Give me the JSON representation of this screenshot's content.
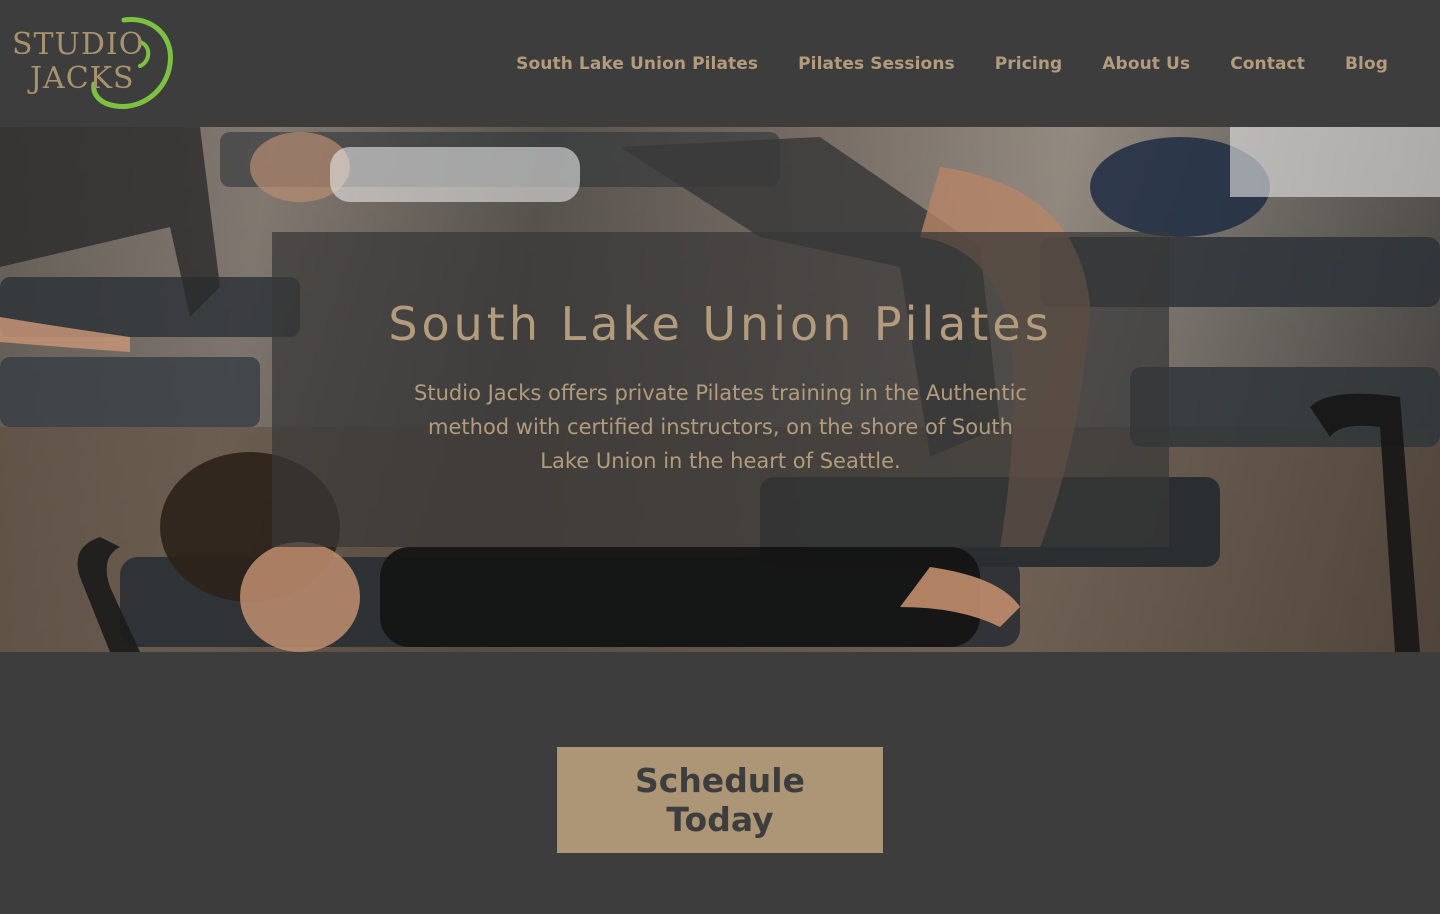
{
  "header": {
    "logo": {
      "line1": "STUDIO",
      "line2": "JACKS",
      "accent_color": "#7dc142",
      "text_color": "#a8936f"
    },
    "nav": [
      {
        "label": "South Lake Union Pilates"
      },
      {
        "label": "Pilates Sessions"
      },
      {
        "label": "Pricing"
      },
      {
        "label": "About Us"
      },
      {
        "label": "Contact"
      },
      {
        "label": "Blog"
      }
    ]
  },
  "hero": {
    "title": "South Lake Union Pilates",
    "text": "Studio Jacks offers private Pilates training in the Authentic method with certified instructors, on the shore of South Lake Union in the heart of Seattle.",
    "image": "photo-pilates-reformer-class"
  },
  "cta": {
    "label": "Schedule Today"
  },
  "colors": {
    "background": "#3d3d3d",
    "accent_tan": "#b39c7d",
    "button_bg": "#ad9676",
    "logo_green": "#7dc142"
  }
}
